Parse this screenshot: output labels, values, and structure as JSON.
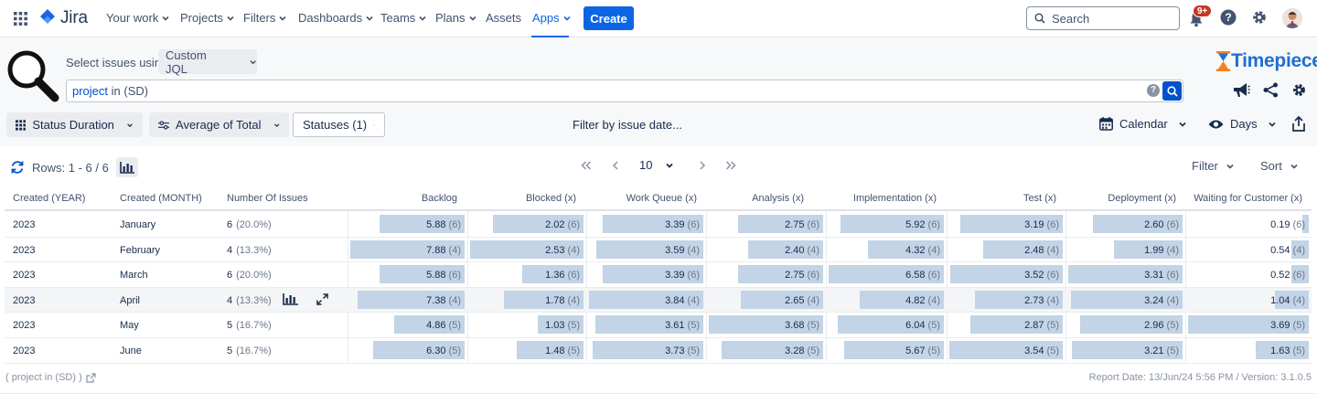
{
  "nav": {
    "product": "Jira",
    "items": [
      "Your work",
      "Projects",
      "Filters",
      "Dashboards",
      "Teams",
      "Plans",
      "Assets",
      "Apps"
    ],
    "create": "Create",
    "search_placeholder": "Search",
    "notifications_badge": "9+"
  },
  "query": {
    "select_label": "Select issues using",
    "mode": "Custom JQL",
    "jql_keyword": "project",
    "jql_rest": " in (SD)",
    "brand": "Timepiece"
  },
  "toolbar": {
    "status_duration": "Status Duration",
    "average": "Average of Total",
    "statuses": "Statuses (1)",
    "filter_date": "Filter by issue date...",
    "calendar": "Calendar",
    "days": "Days"
  },
  "rows_info": "Rows: 1 - 6 / 6",
  "page_size": "10",
  "filter_label": "Filter",
  "sort_label": "Sort",
  "table": {
    "headers": [
      "Created (YEAR)",
      "Created (MONTH)",
      "Number Of Issues",
      "Backlog",
      "Blocked (x)",
      "Work Queue (x)",
      "Analysis (x)",
      "Implementation (x)",
      "Test (x)",
      "Deployment (x)",
      "Waiting for Customer (x)"
    ],
    "rows": [
      {
        "year": "2023",
        "month": "January",
        "issues": "6",
        "pct": "(20.0%)",
        "cells": [
          [
            "5.88",
            "(6)"
          ],
          [
            "2.02",
            "(6)"
          ],
          [
            "3.39",
            "(6)"
          ],
          [
            "2.75",
            "(6)"
          ],
          [
            "5.92",
            "(6)"
          ],
          [
            "3.19",
            "(6)"
          ],
          [
            "2.60",
            "(6)"
          ],
          [
            "0.19",
            "(6)"
          ]
        ]
      },
      {
        "year": "2023",
        "month": "February",
        "issues": "4",
        "pct": "(13.3%)",
        "cells": [
          [
            "7.88",
            "(4)"
          ],
          [
            "2.53",
            "(4)"
          ],
          [
            "3.59",
            "(4)"
          ],
          [
            "2.40",
            "(4)"
          ],
          [
            "4.32",
            "(4)"
          ],
          [
            "2.48",
            "(4)"
          ],
          [
            "1.99",
            "(4)"
          ],
          [
            "0.54",
            "(4)"
          ]
        ]
      },
      {
        "year": "2023",
        "month": "March",
        "issues": "6",
        "pct": "(20.0%)",
        "cells": [
          [
            "5.88",
            "(6)"
          ],
          [
            "1.36",
            "(6)"
          ],
          [
            "3.39",
            "(6)"
          ],
          [
            "2.75",
            "(6)"
          ],
          [
            "6.58",
            "(6)"
          ],
          [
            "3.52",
            "(6)"
          ],
          [
            "3.31",
            "(6)"
          ],
          [
            "0.52",
            "(6)"
          ]
        ]
      },
      {
        "year": "2023",
        "month": "April",
        "issues": "4",
        "pct": "(13.3%)",
        "cells": [
          [
            "7.38",
            "(4)"
          ],
          [
            "1.78",
            "(4)"
          ],
          [
            "3.84",
            "(4)"
          ],
          [
            "2.65",
            "(4)"
          ],
          [
            "4.82",
            "(4)"
          ],
          [
            "2.73",
            "(4)"
          ],
          [
            "3.24",
            "(4)"
          ],
          [
            "1.04",
            "(4)"
          ]
        ]
      },
      {
        "year": "2023",
        "month": "May",
        "issues": "5",
        "pct": "(16.7%)",
        "cells": [
          [
            "4.86",
            "(5)"
          ],
          [
            "1.03",
            "(5)"
          ],
          [
            "3.61",
            "(5)"
          ],
          [
            "3.68",
            "(5)"
          ],
          [
            "6.04",
            "(5)"
          ],
          [
            "2.87",
            "(5)"
          ],
          [
            "2.96",
            "(5)"
          ],
          [
            "3.69",
            "(5)"
          ]
        ]
      },
      {
        "year": "2023",
        "month": "June",
        "issues": "5",
        "pct": "(16.7%)",
        "cells": [
          [
            "6.30",
            "(5)"
          ],
          [
            "1.48",
            "(5)"
          ],
          [
            "3.73",
            "(5)"
          ],
          [
            "3.28",
            "(5)"
          ],
          [
            "5.67",
            "(5)"
          ],
          [
            "3.54",
            "(5)"
          ],
          [
            "3.21",
            "(5)"
          ],
          [
            "1.63",
            "(5)"
          ]
        ]
      }
    ],
    "column_max": [
      7.88,
      2.53,
      3.84,
      3.68,
      6.58,
      3.54,
      3.31,
      3.69
    ]
  },
  "footer": {
    "jql": "( project in (SD) )",
    "report": "Report Date: 13/Jun/24 5:56 PM / Version: 3.1.0.5"
  },
  "colors": {
    "accent": "#0c66e4",
    "bar": "#c2d4e5",
    "brand_orange": "#f5821f",
    "brand_blue": "#1f6fd1"
  }
}
